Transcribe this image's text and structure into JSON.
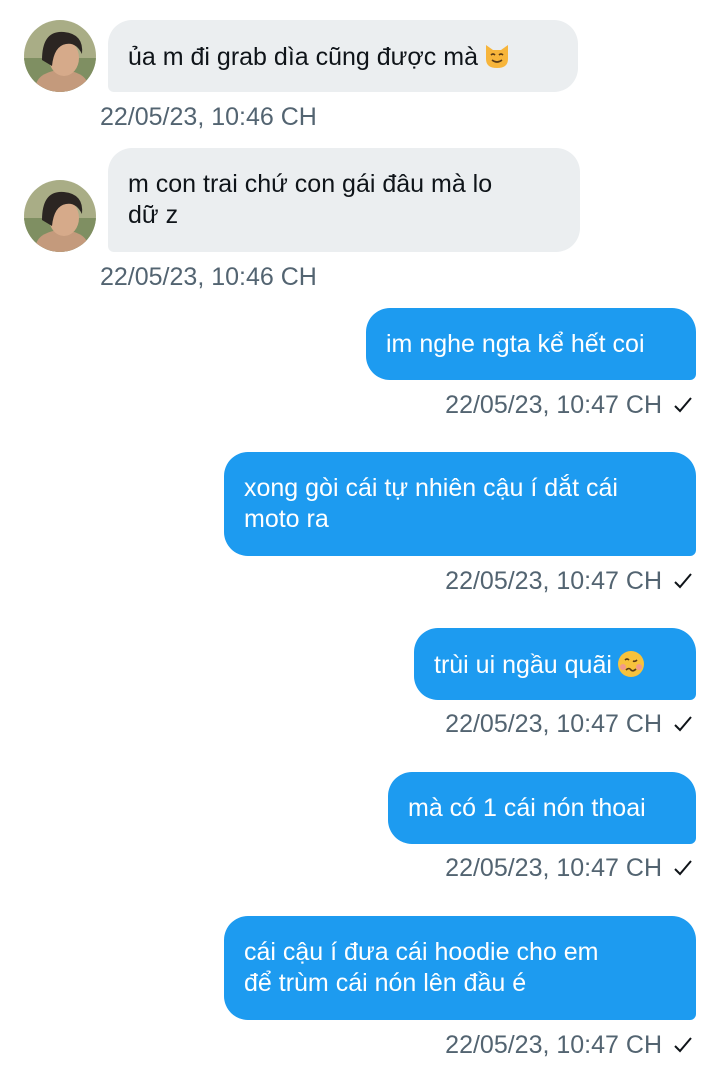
{
  "colors": {
    "incoming_bubble": "#ebeef0",
    "outgoing_bubble": "#1d9bf0",
    "timestamp": "#536471"
  },
  "messages": [
    {
      "direction": "incoming",
      "lines": [
        "ủa m đi grab dìa cũng được mà"
      ],
      "trailing_icon": "cat-face-emoji",
      "time": "22/05/23, 10:46 CH"
    },
    {
      "direction": "incoming",
      "lines": [
        "m con trai chứ con gái đâu mà lo",
        "dữ z"
      ],
      "time": "22/05/23, 10:46 CH"
    },
    {
      "direction": "outgoing",
      "lines": [
        "im nghe ngta kể hết coi"
      ],
      "time": "22/05/23, 10:47 CH",
      "status_icon": "checkmark-icon"
    },
    {
      "direction": "outgoing",
      "lines": [
        "xong gòi cái tự nhiên cậu í dắt cái",
        "moto ra"
      ],
      "time": "22/05/23, 10:47 CH",
      "status_icon": "checkmark-icon"
    },
    {
      "direction": "outgoing",
      "lines": [
        "trùi ui ngầu quãi"
      ],
      "trailing_icon": "woozy-face-emoji",
      "time": "22/05/23, 10:47 CH",
      "status_icon": "checkmark-icon"
    },
    {
      "direction": "outgoing",
      "lines": [
        "mà có 1 cái nón thoai"
      ],
      "time": "22/05/23, 10:47 CH",
      "status_icon": "checkmark-icon"
    },
    {
      "direction": "outgoing",
      "lines": [
        "cái cậu í đưa cái hoodie cho em",
        "để trùm cái nón lên đầu é"
      ],
      "time": "22/05/23, 10:47 CH",
      "status_icon": "checkmark-icon"
    }
  ]
}
